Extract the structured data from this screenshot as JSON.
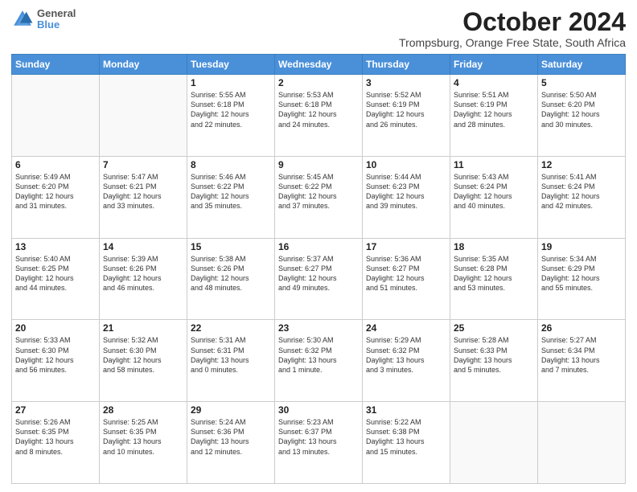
{
  "header": {
    "logo": {
      "line1": "General",
      "line2": "Blue"
    },
    "title": "October 2024",
    "subtitle": "Trompsburg, Orange Free State, South Africa"
  },
  "days_of_week": [
    "Sunday",
    "Monday",
    "Tuesday",
    "Wednesday",
    "Thursday",
    "Friday",
    "Saturday"
  ],
  "weeks": [
    [
      {
        "day": "",
        "info": ""
      },
      {
        "day": "",
        "info": ""
      },
      {
        "day": "1",
        "info": "Sunrise: 5:55 AM\nSunset: 6:18 PM\nDaylight: 12 hours\nand 22 minutes."
      },
      {
        "day": "2",
        "info": "Sunrise: 5:53 AM\nSunset: 6:18 PM\nDaylight: 12 hours\nand 24 minutes."
      },
      {
        "day": "3",
        "info": "Sunrise: 5:52 AM\nSunset: 6:19 PM\nDaylight: 12 hours\nand 26 minutes."
      },
      {
        "day": "4",
        "info": "Sunrise: 5:51 AM\nSunset: 6:19 PM\nDaylight: 12 hours\nand 28 minutes."
      },
      {
        "day": "5",
        "info": "Sunrise: 5:50 AM\nSunset: 6:20 PM\nDaylight: 12 hours\nand 30 minutes."
      }
    ],
    [
      {
        "day": "6",
        "info": "Sunrise: 5:49 AM\nSunset: 6:20 PM\nDaylight: 12 hours\nand 31 minutes."
      },
      {
        "day": "7",
        "info": "Sunrise: 5:47 AM\nSunset: 6:21 PM\nDaylight: 12 hours\nand 33 minutes."
      },
      {
        "day": "8",
        "info": "Sunrise: 5:46 AM\nSunset: 6:22 PM\nDaylight: 12 hours\nand 35 minutes."
      },
      {
        "day": "9",
        "info": "Sunrise: 5:45 AM\nSunset: 6:22 PM\nDaylight: 12 hours\nand 37 minutes."
      },
      {
        "day": "10",
        "info": "Sunrise: 5:44 AM\nSunset: 6:23 PM\nDaylight: 12 hours\nand 39 minutes."
      },
      {
        "day": "11",
        "info": "Sunrise: 5:43 AM\nSunset: 6:24 PM\nDaylight: 12 hours\nand 40 minutes."
      },
      {
        "day": "12",
        "info": "Sunrise: 5:41 AM\nSunset: 6:24 PM\nDaylight: 12 hours\nand 42 minutes."
      }
    ],
    [
      {
        "day": "13",
        "info": "Sunrise: 5:40 AM\nSunset: 6:25 PM\nDaylight: 12 hours\nand 44 minutes."
      },
      {
        "day": "14",
        "info": "Sunrise: 5:39 AM\nSunset: 6:26 PM\nDaylight: 12 hours\nand 46 minutes."
      },
      {
        "day": "15",
        "info": "Sunrise: 5:38 AM\nSunset: 6:26 PM\nDaylight: 12 hours\nand 48 minutes."
      },
      {
        "day": "16",
        "info": "Sunrise: 5:37 AM\nSunset: 6:27 PM\nDaylight: 12 hours\nand 49 minutes."
      },
      {
        "day": "17",
        "info": "Sunrise: 5:36 AM\nSunset: 6:27 PM\nDaylight: 12 hours\nand 51 minutes."
      },
      {
        "day": "18",
        "info": "Sunrise: 5:35 AM\nSunset: 6:28 PM\nDaylight: 12 hours\nand 53 minutes."
      },
      {
        "day": "19",
        "info": "Sunrise: 5:34 AM\nSunset: 6:29 PM\nDaylight: 12 hours\nand 55 minutes."
      }
    ],
    [
      {
        "day": "20",
        "info": "Sunrise: 5:33 AM\nSunset: 6:30 PM\nDaylight: 12 hours\nand 56 minutes."
      },
      {
        "day": "21",
        "info": "Sunrise: 5:32 AM\nSunset: 6:30 PM\nDaylight: 12 hours\nand 58 minutes."
      },
      {
        "day": "22",
        "info": "Sunrise: 5:31 AM\nSunset: 6:31 PM\nDaylight: 13 hours\nand 0 minutes."
      },
      {
        "day": "23",
        "info": "Sunrise: 5:30 AM\nSunset: 6:32 PM\nDaylight: 13 hours\nand 1 minute."
      },
      {
        "day": "24",
        "info": "Sunrise: 5:29 AM\nSunset: 6:32 PM\nDaylight: 13 hours\nand 3 minutes."
      },
      {
        "day": "25",
        "info": "Sunrise: 5:28 AM\nSunset: 6:33 PM\nDaylight: 13 hours\nand 5 minutes."
      },
      {
        "day": "26",
        "info": "Sunrise: 5:27 AM\nSunset: 6:34 PM\nDaylight: 13 hours\nand 7 minutes."
      }
    ],
    [
      {
        "day": "27",
        "info": "Sunrise: 5:26 AM\nSunset: 6:35 PM\nDaylight: 13 hours\nand 8 minutes."
      },
      {
        "day": "28",
        "info": "Sunrise: 5:25 AM\nSunset: 6:35 PM\nDaylight: 13 hours\nand 10 minutes."
      },
      {
        "day": "29",
        "info": "Sunrise: 5:24 AM\nSunset: 6:36 PM\nDaylight: 13 hours\nand 12 minutes."
      },
      {
        "day": "30",
        "info": "Sunrise: 5:23 AM\nSunset: 6:37 PM\nDaylight: 13 hours\nand 13 minutes."
      },
      {
        "day": "31",
        "info": "Sunrise: 5:22 AM\nSunset: 6:38 PM\nDaylight: 13 hours\nand 15 minutes."
      },
      {
        "day": "",
        "info": ""
      },
      {
        "day": "",
        "info": ""
      }
    ]
  ]
}
